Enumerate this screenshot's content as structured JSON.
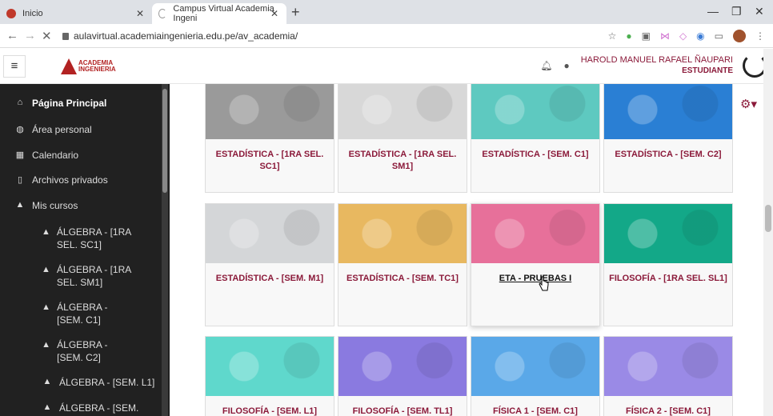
{
  "browser": {
    "tabs": [
      {
        "title": "Inicio"
      },
      {
        "title": "Campus Virtual Academia Ingeni"
      }
    ],
    "url": "aulavirtual.academiaingenieria.edu.pe/av_academia/"
  },
  "header": {
    "logo_line1": "ACADEMIA",
    "logo_line2": "INGENIERIA",
    "user_name": "HAROLD MANUEL RAFAEL ÑAUPARI",
    "user_role": "ESTUDIANTE"
  },
  "sidebar": {
    "items": [
      {
        "label": "Página Principal",
        "icon": "home-icon"
      },
      {
        "label": "Área personal",
        "icon": "dashboard-icon"
      },
      {
        "label": "Calendario",
        "icon": "calendar-icon"
      },
      {
        "label": "Archivos privados",
        "icon": "file-icon"
      },
      {
        "label": "Mis cursos",
        "icon": "graduation-cap-icon"
      },
      {
        "label": "ÁLGEBRA - [1RA SEL. SC1]",
        "icon": "graduation-cap-icon"
      },
      {
        "label": "ÁLGEBRA - [1RA SEL. SM1]",
        "icon": "graduation-cap-icon"
      },
      {
        "label": "ÁLGEBRA - [SEM. C1]",
        "icon": "graduation-cap-icon"
      },
      {
        "label": "ÁLGEBRA - [SEM. C2]",
        "icon": "graduation-cap-icon"
      },
      {
        "label": "ÁLGEBRA - [SEM. L1]",
        "icon": "graduation-cap-icon"
      },
      {
        "label": "ÁLGEBRA - [SEM.",
        "icon": "graduation-cap-icon"
      }
    ]
  },
  "courses": [
    {
      "title": "ESTADÍSTICA - [1RA SEL. SC1]",
      "color": "#9a9a9a"
    },
    {
      "title": "ESTADÍSTICA - [1RA SEL. SM1]",
      "color": "#d8d8d8"
    },
    {
      "title": "ESTADÍSTICA - [SEM. C1]",
      "color": "#5ec9c0"
    },
    {
      "title": "ESTADÍSTICA - [SEM. C2]",
      "color": "#2a7fd4"
    },
    {
      "title": "ESTADÍSTICA - [SEM. M1]",
      "color": "#d4d6d8"
    },
    {
      "title": "ESTADÍSTICA - [SEM. TC1]",
      "color": "#e8b860"
    },
    {
      "title": "ETA - PRUEBAS I",
      "color": "#e7709a"
    },
    {
      "title": "FILOSOFÍA - [1RA SEL. SL1]",
      "color": "#13a888"
    },
    {
      "title": "FILOSOFÍA - [SEM. L1]",
      "color": "#5fd8cc"
    },
    {
      "title": "FILOSOFÍA - [SEM. TL1]",
      "color": "#8a7ae0"
    },
    {
      "title": "FÍSICA 1 - [SEM. C1]",
      "color": "#5aa8e8"
    },
    {
      "title": "FÍSICA 2 - [SEM. C1]",
      "color": "#9a8ae6"
    }
  ]
}
